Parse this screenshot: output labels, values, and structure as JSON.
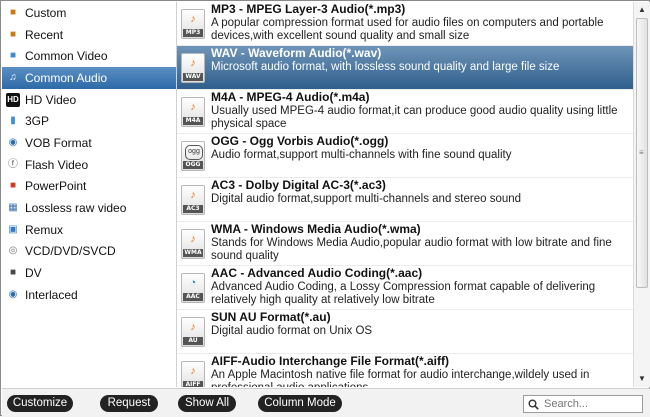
{
  "sidebar": {
    "items": [
      {
        "label": "Custom",
        "icon": "custom-folder-icon",
        "glyph": "■",
        "color": "#c77b1a"
      },
      {
        "label": "Recent",
        "icon": "recent-folder-icon",
        "glyph": "■",
        "color": "#c77b1a"
      },
      {
        "label": "Common Video",
        "icon": "common-video-icon",
        "glyph": "■",
        "color": "#3a8ed3"
      },
      {
        "label": "Common Audio",
        "icon": "music-note-icon",
        "glyph": "♫",
        "color": "#ffffff"
      },
      {
        "label": "HD Video",
        "icon": "hd-icon",
        "glyph": "HD",
        "color": "#111111"
      },
      {
        "label": "3GP",
        "icon": "mobile-phone-icon",
        "glyph": "▮",
        "color": "#3a8ed3"
      },
      {
        "label": "VOB Format",
        "icon": "vob-disc-icon",
        "glyph": "◉",
        "color": "#2a6db0"
      },
      {
        "label": "Flash Video",
        "icon": "flash-icon",
        "glyph": "ⓕ",
        "color": "#555555"
      },
      {
        "label": "PowerPoint",
        "icon": "powerpoint-icon",
        "glyph": "■",
        "color": "#d13b1f"
      },
      {
        "label": "Lossless raw video",
        "icon": "film-icon",
        "glyph": "▦",
        "color": "#3a6fb0"
      },
      {
        "label": "Remux",
        "icon": "remux-icon",
        "glyph": "▣",
        "color": "#2f7bc8"
      },
      {
        "label": "VCD/DVD/SVCD",
        "icon": "dvd-disc-icon",
        "glyph": "◎",
        "color": "#777777"
      },
      {
        "label": "DV",
        "icon": "dv-camera-icon",
        "glyph": "■",
        "color": "#4a4a4a"
      },
      {
        "label": "Interlaced",
        "icon": "interlaced-icon",
        "glyph": "◉",
        "color": "#2a6db0"
      }
    ],
    "selected_index": 3
  },
  "formats": [
    {
      "title": "MP3 - MPEG Layer-3 Audio(*.mp3)",
      "desc": "A popular compression format used for audio files on computers and portable devices,with excellent sound quality and small size",
      "tag": "MP3",
      "icon": "mp3-file-icon",
      "glyph": "♪"
    },
    {
      "title": "WAV - Waveform Audio(*.wav)",
      "desc": "Microsoft audio format, with lossless sound quality and large file size",
      "tag": "WAV",
      "icon": "wav-file-icon",
      "glyph": "♪"
    },
    {
      "title": "M4A - MPEG-4 Audio(*.m4a)",
      "desc": "Usually used MPEG-4 audio format,it can produce good audio quality using little physical space",
      "tag": "M4A",
      "icon": "m4a-file-icon",
      "glyph": "♪"
    },
    {
      "title": "OGG - Ogg Vorbis Audio(*.ogg)",
      "desc": "Audio format,support multi-channels with fine sound quality",
      "tag": "OGG",
      "icon": "ogg-file-icon",
      "glyph": "ogg"
    },
    {
      "title": "AC3 - Dolby Digital AC-3(*.ac3)",
      "desc": "Digital audio format,support multi-channels and stereo sound",
      "tag": "AC3",
      "icon": "ac3-file-icon",
      "glyph": "♪"
    },
    {
      "title": "WMA - Windows Media Audio(*.wma)",
      "desc": "Stands for Windows Media Audio,popular audio format with low bitrate and fine sound quality",
      "tag": "WMA",
      "icon": "wma-file-icon",
      "glyph": "♪"
    },
    {
      "title": "AAC - Advanced Audio Coding(*.aac)",
      "desc": "Advanced Audio Coding, a Lossy Compression format capable of delivering relatively high quality at relatively low bitrate",
      "tag": "AAC",
      "icon": "aac-file-icon",
      "glyph": "◔"
    },
    {
      "title": "SUN AU Format(*.au)",
      "desc": "Digital audio format on Unix OS",
      "tag": "AU",
      "icon": "au-file-icon",
      "glyph": "♪"
    },
    {
      "title": "AIFF-Audio Interchange File Format(*.aiff)",
      "desc": "An Apple Macintosh native file format for audio interchange,wildely used in professional audio applications",
      "tag": "AIFF",
      "icon": "aiff-file-icon",
      "glyph": "♪"
    }
  ],
  "selected_format_index": 1,
  "buttons": {
    "customize": "Customize",
    "request": "Request",
    "show_all": "Show All",
    "column_mode": "Column Mode"
  },
  "search": {
    "placeholder": "Search...",
    "value": ""
  }
}
